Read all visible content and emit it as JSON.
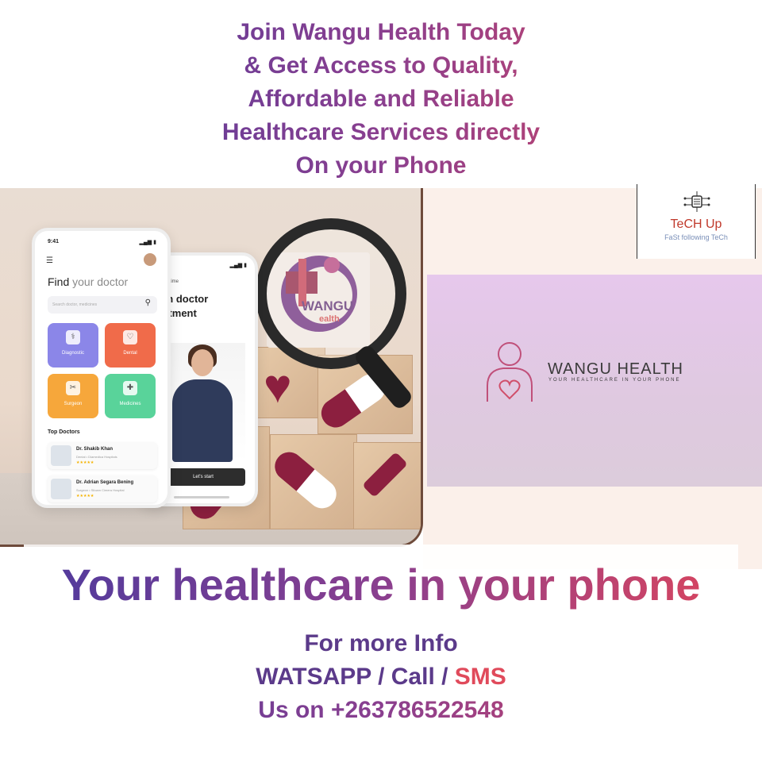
{
  "headline": {
    "lines": [
      "Join Wangu Health Today",
      "& Get Access to Quality,",
      "Affordable and Reliable",
      "Healthcare Services directly",
      "On your Phone"
    ]
  },
  "phone_1": {
    "time": "9:41",
    "signal": "▂▄▆ ▮",
    "menu_icon": "hamburger-icon",
    "title_find": "Find",
    "title_rest": " your doctor",
    "search_placeholder": "Search doctor, medicines",
    "search_icon": "search-icon",
    "categories": [
      {
        "label": "Diagnostic",
        "color": "#8b86e8",
        "icon": "stethoscope-icon",
        "glyph": "⚕"
      },
      {
        "label": "Dental",
        "color": "#f06b4a",
        "icon": "tooth-icon",
        "glyph": "♡"
      },
      {
        "label": "Surgeon",
        "color": "#f6a73b",
        "icon": "syringe-icon",
        "glyph": "✂"
      },
      {
        "label": "Medicines",
        "color": "#59d39a",
        "icon": "medicine-icon",
        "glyph": "✚"
      }
    ],
    "top_doctors_label": "Top Doctors",
    "doctors": [
      {
        "name": "Dr. Shakib Khan",
        "meta": "Dental • Diamedica Hospitals",
        "stars": "★★★★★"
      },
      {
        "name": "Dr. Adrian Segara Bening",
        "meta": "Surgeon • Siloam Cimera Hospital",
        "stars": "★★★★★"
      }
    ]
  },
  "phone_2": {
    "signal": "▂▄▆ ▮",
    "caption": "Save your time",
    "heading_line1": "ke an doctor",
    "heading_line2": "pointment",
    "button_label": "Let's start"
  },
  "magnifier_logo": {
    "text": "WANGU",
    "sub": "ealth"
  },
  "techup": {
    "title": "TeCH Up",
    "subtitle": "FaSt following TeCh",
    "icon": "circuit-chip-icon"
  },
  "brand": {
    "title": "WANGU HEALTH",
    "tagline": "YOUR HEALTHCARE IN YOUR PHONE",
    "icon": "person-heart-icon"
  },
  "tagline": "Your healthcare in your phone",
  "contact": {
    "line1": "For more Info",
    "line2_a": "WATSAPP / Call / ",
    "line2_b": "SMS",
    "line3": "Us on +263786522548"
  },
  "colors": {
    "gradient_start": "#4b3a9e",
    "gradient_end": "#e0455a",
    "brand_red": "#8c1f3f"
  }
}
